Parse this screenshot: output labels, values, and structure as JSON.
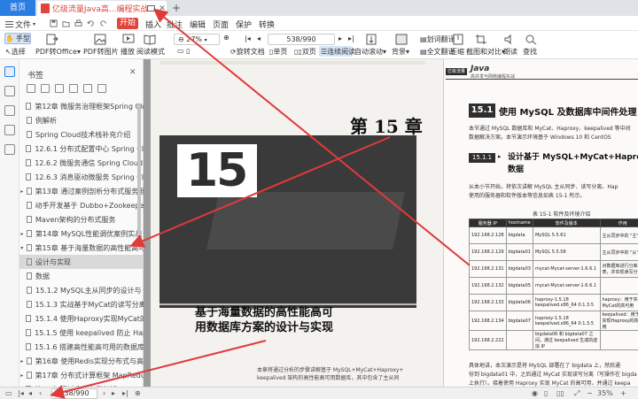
{
  "tabs": {
    "home": "首页",
    "document": "亿级流量Java高...编程实战 .pdf",
    "add": "+"
  },
  "menu": {
    "file": "文件",
    "items": [
      "开始",
      "插入",
      "批注",
      "编辑",
      "页面",
      "保护",
      "转换"
    ]
  },
  "toolbar": {
    "hand": "手型",
    "select": "选择",
    "pdf_to_office": "PDF转Office",
    "pdf_to_image": "PDF转图片",
    "play": "播放",
    "read_mode": "阅读模式",
    "zoom": "27%",
    "page": "538/990",
    "rotate": "旋转文档",
    "single": "单页",
    "double": "双页",
    "continuous": "连续阅读",
    "auto_scroll": "自动滚动",
    "background": "背景",
    "translate_word": "划词翻译",
    "translate_full": "全文翻译",
    "compress": "压缩",
    "screenshot_compare": "截图和对比",
    "read_aloud": "朗读",
    "find": "查找"
  },
  "panel": {
    "title": "书签",
    "bookmarks": [
      {
        "label": "第12章 微服务治理框架Spring Cloud",
        "caret": "",
        "sel": false
      },
      {
        "label": "例解析",
        "caret": "",
        "sel": false
      },
      {
        "label": "Spring Cloud技术栈补充介绍",
        "caret": "",
        "sel": false
      },
      {
        "label": "12.6.1 分布式配置中心 Spring Cloud",
        "caret": "",
        "sel": false
      },
      {
        "label": "12.6.2 微服务通信 Spring Cloud Bus",
        "caret": "",
        "sel": false
      },
      {
        "label": "12.6.3 消息驱动微服务 Spring Cloud",
        "caret": "",
        "sel": false
      },
      {
        "label": "第13章 通过案例剖析分布式服务框架",
        "caret": "▸",
        "sel": false
      },
      {
        "label": "动手开发基于 Dubbo+Zookeeper+",
        "caret": "",
        "sel": false
      },
      {
        "label": "Maven架构的分布式服务",
        "caret": "",
        "sel": false
      },
      {
        "label": "第14章 MySQL性能调优案例实战",
        "caret": "▸",
        "sel": false
      },
      {
        "label": "第15章 基于海量数据的高性能高可用",
        "caret": "▾",
        "sel": false
      },
      {
        "label": "设计与实现",
        "caret": "",
        "sel": true
      },
      {
        "label": "数据",
        "caret": "",
        "sel": false
      },
      {
        "label": "15.1.2 MySQL主从同步的设计与",
        "caret": "",
        "sel": false
      },
      {
        "label": "15.1.3 实战基于MyCat的读写分离与",
        "caret": "",
        "sel": false
      },
      {
        "label": "15.1.4 使用Haproxy实现MyCat的高",
        "caret": "",
        "sel": false
      },
      {
        "label": "15.1.5 使用 keepalived 防止 Haproxy",
        "caret": "",
        "sel": false
      },
      {
        "label": "15.1.6 搭建高性能高可用的数据库的Mys",
        "caret": "",
        "sel": false
      },
      {
        "label": "第16章 使用Redis实现分布式与高效",
        "caret": "▸",
        "sel": false
      },
      {
        "label": "第17章 分布式计算框架 MapReduce",
        "caret": "▸",
        "sel": false
      },
      {
        "label": "第18章 通过典型案例剖析 MapReduce",
        "caret": "▸",
        "sel": false
      }
    ]
  },
  "left_page": {
    "chapter_number": "15",
    "chapter_label": "第 15 章",
    "chapter_title_line1": "基于海量数据的高性能高可",
    "chapter_title_line2": "用数据库方案的设计与实现",
    "intro_line1": "本章将通过分析的步骤讲解基于 MySQL+MyCat+Haproxy+",
    "intro_line2": "keepalived 架构的高性能高可用数据库，其中包含了主从同"
  },
  "right_page": {
    "header_badge": "亿级流量",
    "header_java": "Java",
    "header_sub": "高并发与网络编程实战",
    "section_num": "15.1",
    "section_title": "使用 MySQL 及数据库中间件处理",
    "para1_line1": "本节通过 MySQL 数据库和 MyCat、Haproxy、keepalived 等中间",
    "para1_line2": "数据解决方案。本节演示环境基于 Windows 10 和 CentOS",
    "subsec_num": "15.1.1",
    "subsec_arrow": "▸",
    "subsec_title_line1": "设计基于 MySQL+MyCat+Haproxy+ke",
    "subsec_title_line2": "数据",
    "para2_line1": "从本小节开始，将依次讲解 MySQL 主从同步、读写分离、Hap",
    "para2_line2": "使用的服务器和软件版本等信息如表 15-1 所示。",
    "table_caption": "表 15-1   软件及环境介绍",
    "table_headers": [
      "服务器 IP",
      "hostname",
      "软件及版本",
      "作用"
    ],
    "table_rows": [
      [
        "192.168.2.128",
        "bigdata",
        "MySQL 5.5.61",
        "主从同步中的 \"主\""
      ],
      [
        "192.168.2.129",
        "bigdata01",
        "MySQL 5.5.58",
        "主从同步中的 \"从\""
      ],
      [
        "192.168.2.131",
        "bigdata03",
        "mycat-Mycat-server-1.6.6.1",
        "对数据库进行分库分表，并实现读写分离"
      ],
      [
        "192.168.2.132",
        "bigdata05",
        "mycat-Mycat-server-1.6.6.1",
        ""
      ],
      [
        "192.168.2.133",
        "bigdata06",
        "haproxy-1.5.18 keepalived.x86_64 0:1.3.5",
        "haproxy：用于实现MyCat的高可用"
      ],
      [
        "192.168.2.134",
        "bigdata07",
        "haproxy-1.5.18 keepalived.x86_64 0:1.3.5",
        "keepalived：用于实现Haproxy的高可用"
      ],
      [
        "192.168.2.222",
        "",
        "bigdata06 和 bigdata07 之间，通过 keepalived 生成的虚拟 IP",
        ""
      ]
    ],
    "foot_line1": "具体地讲，本次演示是将 MySQL 部署在了 bigdata 上，然后通",
    "foot_line2": "份到 bigdata01 中，之后通过 MyCat 实现读写分离（写操作在 bigda",
    "foot_line3": "上执行）。接着使用 Haproxy 实现 MyCat 的高可用，并通过 keepa"
  },
  "status": {
    "page": "538/990",
    "zoom": "35%"
  },
  "colors": {
    "accent": "#2a7de1",
    "brand_red": "#e0453a",
    "arrow": "#e03a3a"
  }
}
